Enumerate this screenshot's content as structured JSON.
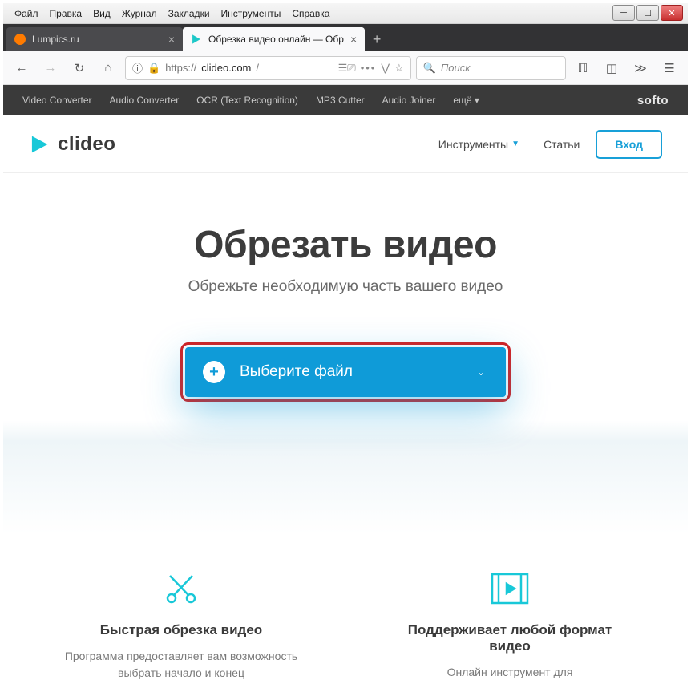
{
  "menubar": [
    "Файл",
    "Правка",
    "Вид",
    "Журнал",
    "Закладки",
    "Инструменты",
    "Справка"
  ],
  "tabs": [
    {
      "title": "Lumpics.ru",
      "active": false
    },
    {
      "title": "Обрезка видео онлайн — Обр",
      "active": true
    }
  ],
  "url": {
    "protocol": "https://",
    "host": "clideo.com",
    "path": "/"
  },
  "searchbar": {
    "placeholder": "Поиск"
  },
  "softo": {
    "items": [
      "Video Converter",
      "Audio Converter",
      "OCR (Text Recognition)",
      "MP3 Cutter",
      "Audio Joiner",
      "ещё ▾"
    ],
    "brand": "softo"
  },
  "header": {
    "brand": "clideo",
    "tools_label": "Инструменты",
    "articles_label": "Статьи",
    "login_label": "Вход"
  },
  "hero": {
    "title": "Обрезать видео",
    "subtitle": "Обрежьте необходимую часть вашего видео",
    "choose_label": "Выберите файл"
  },
  "features": [
    {
      "title": "Быстрая обрезка видео",
      "desc": "Программа предоставляет вам возможность выбрать начало и конец"
    },
    {
      "title": "Поддерживает любой формат видео",
      "desc": "Онлайн инструмент для"
    }
  ]
}
